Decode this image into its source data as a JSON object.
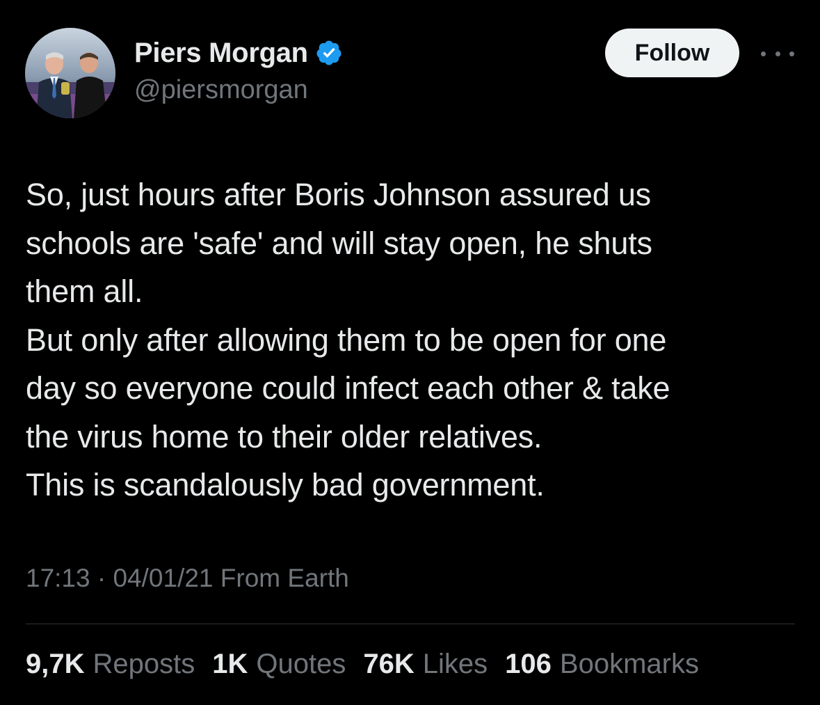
{
  "author": {
    "display_name": "Piers Morgan",
    "handle": "@piersmorgan",
    "verified_icon": "verified-badge-icon",
    "avatar_icon": "profile-photo"
  },
  "actions": {
    "follow_label": "Follow",
    "more_icon": "more-options-icon"
  },
  "tweet": {
    "lines": [
      "So, just hours after Boris Johnson assured us",
      "schools are 'safe' and will stay open, he shuts",
      "them all.",
      "But only after allowing them to be open for one",
      "day so everyone could infect each other & take",
      "the virus home to their older relatives.",
      "This is scandalously bad government."
    ]
  },
  "meta": {
    "time": "17:13",
    "separator": "·",
    "date": "04/01/21",
    "source": "From Earth"
  },
  "stats": [
    {
      "count": "9,7K",
      "label": "Reposts"
    },
    {
      "count": "1K",
      "label": "Quotes"
    },
    {
      "count": "76K",
      "label": "Likes"
    },
    {
      "count": "106",
      "label": "Bookmarks"
    }
  ],
  "colors": {
    "background": "#000000",
    "primary_text": "#e7e9ea",
    "secondary_text": "#71767b",
    "verified_blue": "#1d9bf0",
    "follow_button_bg": "#eff3f4",
    "divider": "#2f3336"
  }
}
